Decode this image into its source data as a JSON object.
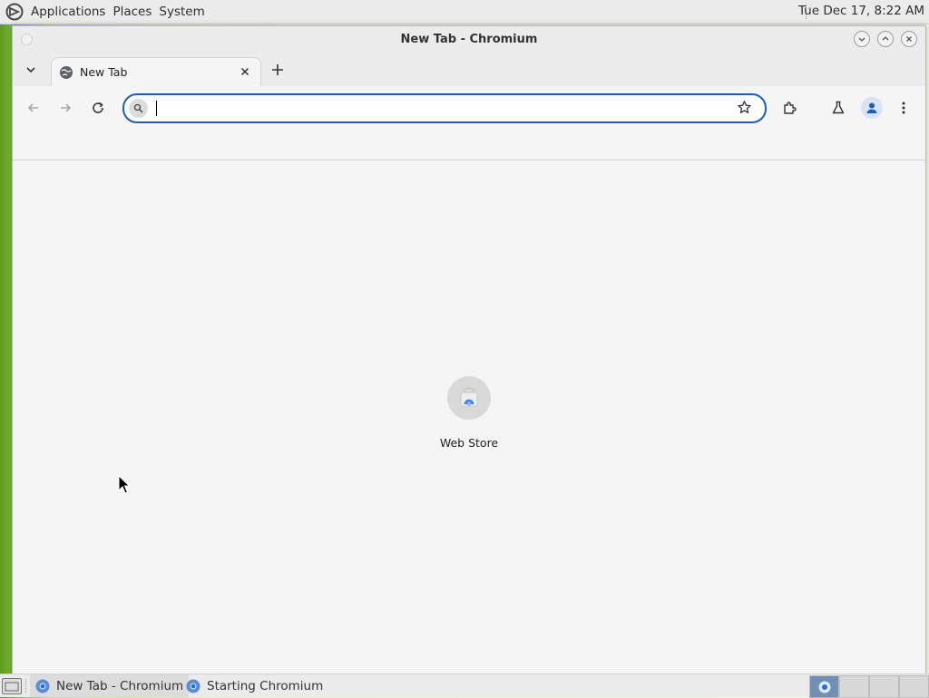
{
  "top_panel": {
    "menus": [
      "Applications",
      "Places",
      "System"
    ],
    "clock": "Tue Dec 17,  8:22 AM",
    "logo_icon": "distro-logo-icon"
  },
  "window": {
    "title": "New Tab - Chromium",
    "buttons": [
      "minimize",
      "maximize",
      "close"
    ]
  },
  "tabs": [
    {
      "label": "New Tab",
      "active": true
    }
  ],
  "toolbar": {
    "omnibox": {
      "value": "",
      "placeholder": ""
    },
    "icons": [
      "back-icon",
      "forward-icon",
      "reload-icon",
      "bookmark-star-icon",
      "extensions-icon",
      "labs-icon",
      "profile-icon",
      "menu-icon"
    ]
  },
  "content": {
    "shortcuts": [
      {
        "label": "Web Store"
      }
    ]
  },
  "taskbar": {
    "items": [
      {
        "label": "New Tab - Chromium",
        "active": true
      },
      {
        "label": "Starting Chromium",
        "active": false
      }
    ],
    "workspaces": 4,
    "current_workspace": 1
  },
  "colors": {
    "accent": "#1a5fb4",
    "panel": "#ebebeb",
    "window_bg": "#f5f5f5"
  }
}
